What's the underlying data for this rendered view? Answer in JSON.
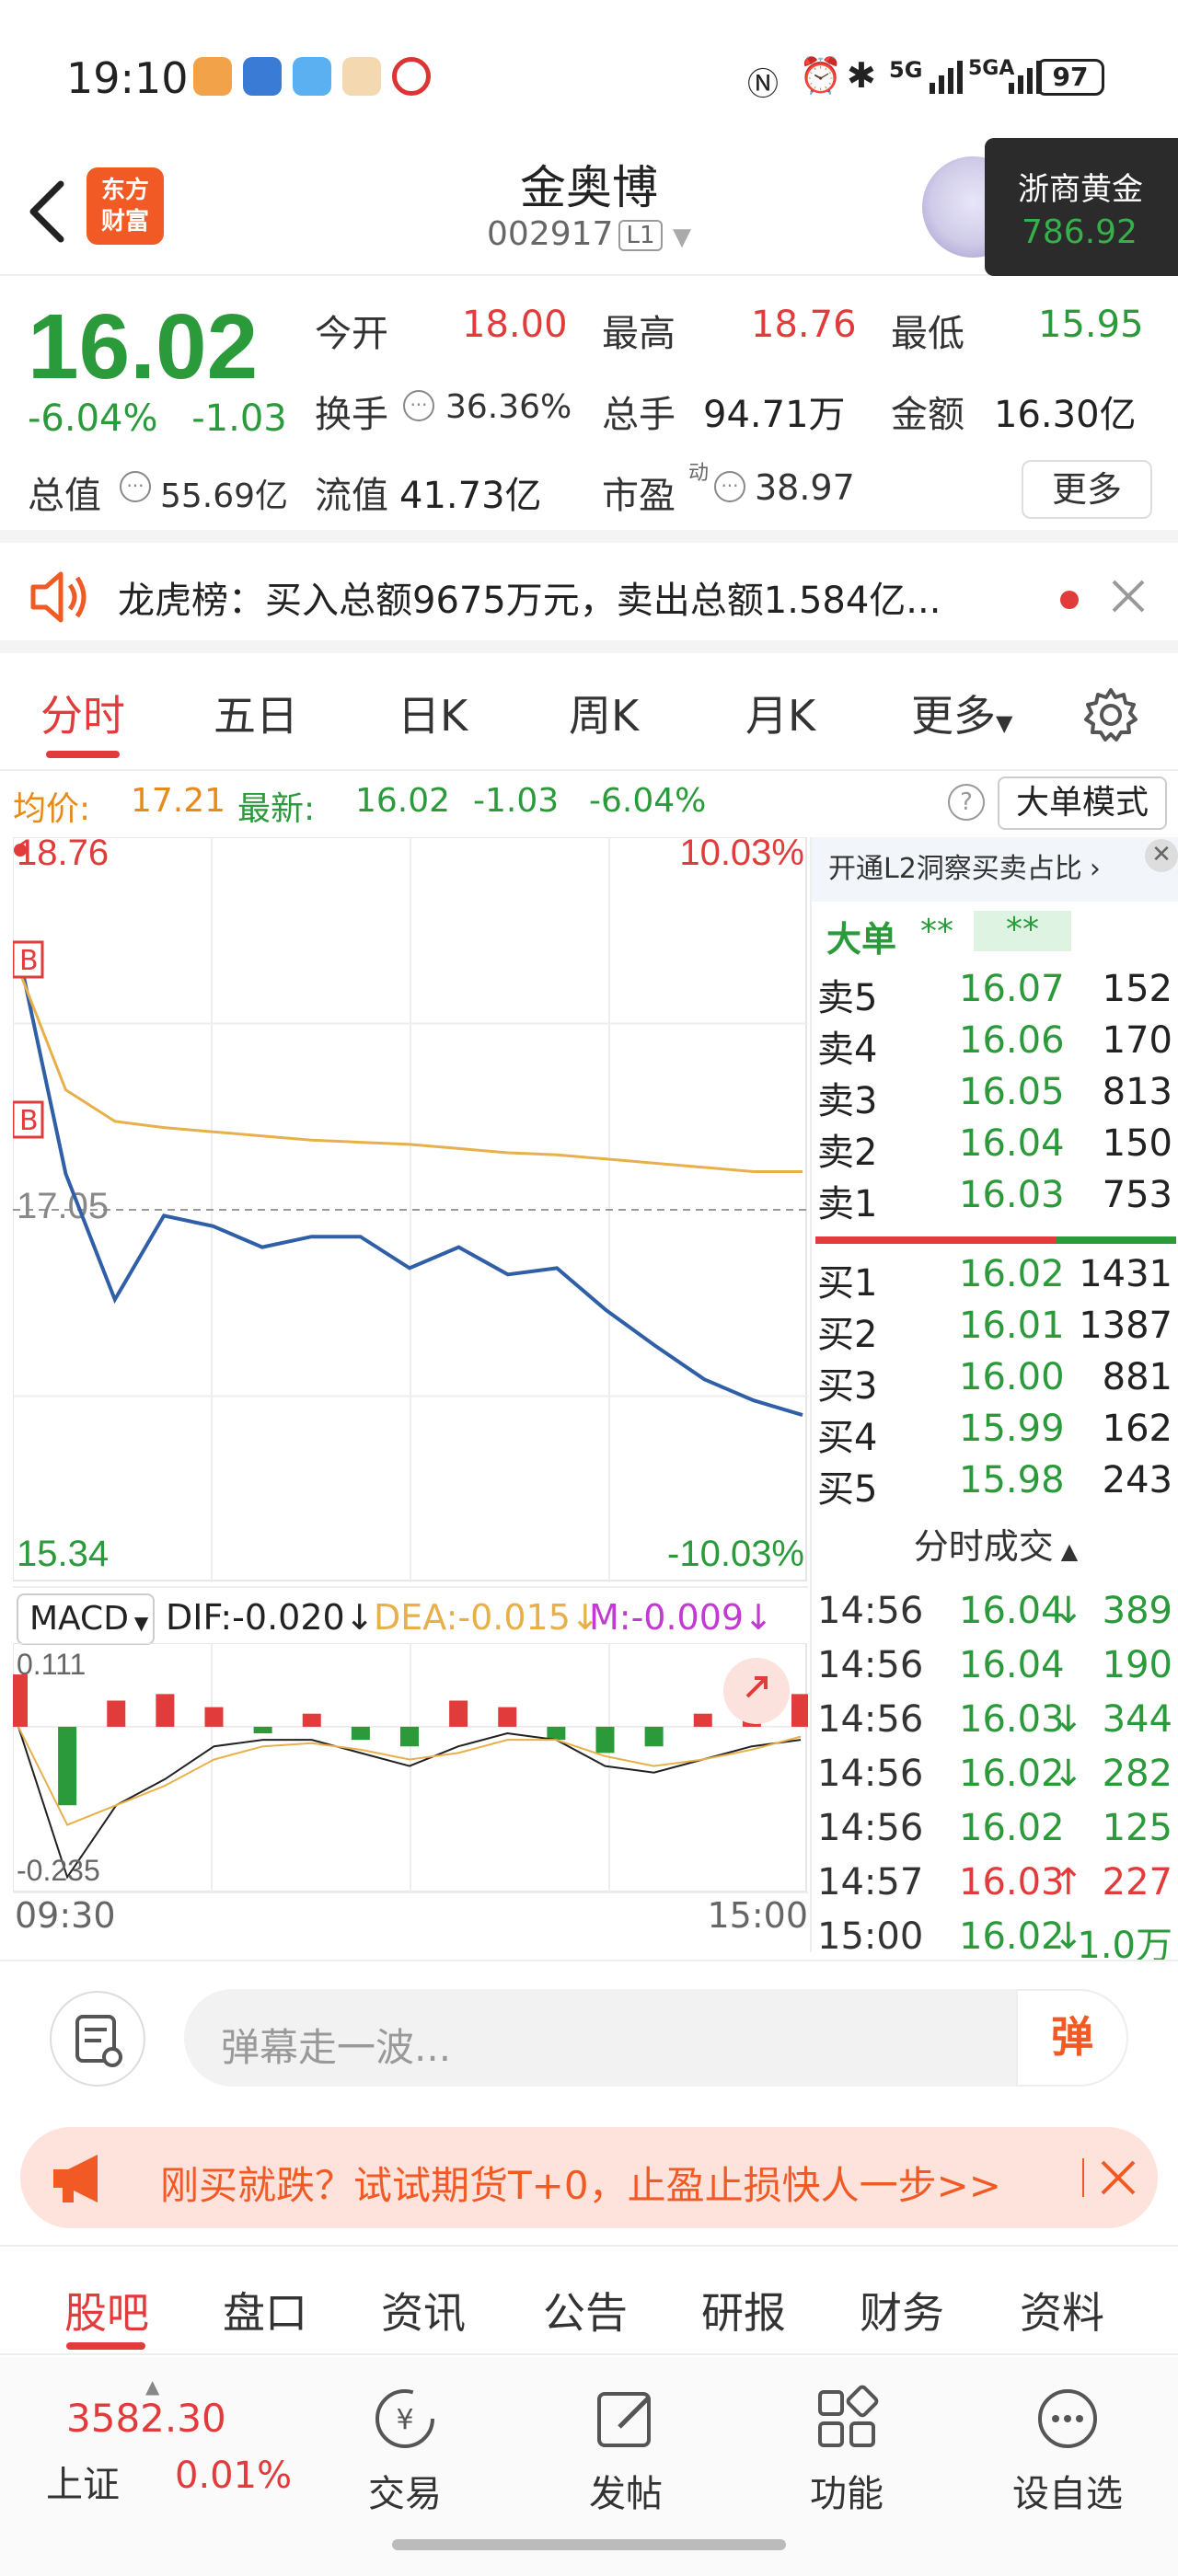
{
  "status_bar": {
    "time": "19:10",
    "network": "5G",
    "network2": "5GA",
    "battery": "97"
  },
  "header": {
    "stock_name": "金奥博",
    "stock_code": "002917",
    "level_badge": "L1",
    "logo_text_line1": "东方",
    "logo_text_line2": "财富",
    "gold_card": {
      "title": "浙商黄金",
      "value": "786.92"
    }
  },
  "quote": {
    "price": "16.02",
    "change_pct": "-6.04%",
    "change": "-1.03",
    "open_label": "今开",
    "open": "18.00",
    "high_label": "最高",
    "high": "18.76",
    "low_label": "最低",
    "low": "15.95",
    "turnover_label": "换手",
    "turnover": "36.36%",
    "volume_label": "总手",
    "volume": "94.71万",
    "amount_label": "金额",
    "amount": "16.30亿",
    "mktcap_label": "总值",
    "mktcap": "55.69亿",
    "float_label": "流值",
    "float": "41.73亿",
    "pe_label": "市盈",
    "pe_sup": "动",
    "pe": "38.97",
    "more_label": "更多"
  },
  "notice": {
    "text": "龙虎榜：买入总额9675万元，卖出总额1.584亿..."
  },
  "tabs": [
    "分时",
    "五日",
    "日K",
    "周K",
    "月K",
    "更多"
  ],
  "infoline": {
    "avg_label": "均价:",
    "avg": "17.21",
    "last_label": "最新:",
    "last": "16.02",
    "chg": "-1.03",
    "chg_pct": "-6.04%",
    "mode_label": "大单模式"
  },
  "chart_labels": {
    "top_price": "18.76",
    "top_pct": "10.03%",
    "mid_price": "17.05",
    "bottom_price": "15.34",
    "bottom_pct": "-10.03%",
    "macd_label": "MACD",
    "dif": "DIF:-0.020",
    "dea": "DEA:-0.015",
    "m": "M:-0.009",
    "macd_top": "0.111",
    "macd_bottom": "-0.235",
    "time_start": "09:30",
    "time_end": "15:00",
    "marker": "B"
  },
  "chart_data": {
    "type": "line",
    "title": "",
    "xlabel": "",
    "ylabel": "",
    "ylim": [
      15.34,
      18.76
    ],
    "x": [
      "09:30",
      "09:45",
      "10:00",
      "10:15",
      "10:30",
      "10:45",
      "11:00",
      "11:15",
      "11:30",
      "13:15",
      "13:30",
      "13:45",
      "14:00",
      "14:15",
      "14:30",
      "14:45",
      "15:00"
    ],
    "series": [
      {
        "values": [
          18.3,
          17.2,
          16.6,
          17.0,
          16.95,
          16.85,
          16.9,
          16.9,
          16.75,
          16.85,
          16.72,
          16.75,
          16.55,
          16.38,
          16.22,
          16.12,
          16.05
        ]
      },
      {
        "values": [
          18.2,
          17.6,
          17.45,
          17.42,
          17.4,
          17.38,
          17.36,
          17.35,
          17.34,
          17.32,
          17.3,
          17.29,
          17.27,
          17.25,
          17.23,
          17.21,
          17.21
        ]
      }
    ],
    "macd": {
      "ylim": [
        -0.235,
        0.111
      ],
      "dif": [
        0.0,
        -0.23,
        -0.12,
        -0.08,
        -0.03,
        -0.02,
        -0.02,
        -0.04,
        -0.06,
        -0.03,
        -0.01,
        -0.02,
        -0.06,
        -0.07,
        -0.05,
        -0.03,
        -0.02
      ],
      "dea": [
        0.0,
        -0.15,
        -0.12,
        -0.09,
        -0.05,
        -0.03,
        -0.025,
        -0.035,
        -0.05,
        -0.04,
        -0.02,
        -0.02,
        -0.045,
        -0.06,
        -0.05,
        -0.035,
        -0.015
      ],
      "hist": [
        0.08,
        -0.12,
        0.04,
        0.05,
        0.03,
        -0.01,
        0.02,
        -0.02,
        -0.03,
        0.04,
        0.03,
        -0.02,
        -0.04,
        -0.03,
        0.02,
        0.03,
        0.05
      ]
    }
  },
  "orderbook": {
    "banner": "开通L2洞察买卖占比",
    "big_label": "大单",
    "stars1": "**",
    "stars2": "**",
    "asks": [
      {
        "label": "卖5",
        "price": "16.07",
        "vol": "152"
      },
      {
        "label": "卖4",
        "price": "16.06",
        "vol": "170"
      },
      {
        "label": "卖3",
        "price": "16.05",
        "vol": "813"
      },
      {
        "label": "卖2",
        "price": "16.04",
        "vol": "150"
      },
      {
        "label": "卖1",
        "price": "16.03",
        "vol": "753"
      }
    ],
    "bids": [
      {
        "label": "买1",
        "price": "16.02",
        "vol": "1431"
      },
      {
        "label": "买2",
        "price": "16.01",
        "vol": "1387"
      },
      {
        "label": "买3",
        "price": "16.00",
        "vol": "881"
      },
      {
        "label": "买4",
        "price": "15.99",
        "vol": "162"
      },
      {
        "label": "买5",
        "price": "15.98",
        "vol": "243"
      }
    ],
    "ticks_title": "分时成交",
    "ticks": [
      {
        "time": "14:56",
        "price": "16.04",
        "dir": "down",
        "vol": "389"
      },
      {
        "time": "14:56",
        "price": "16.04",
        "dir": "",
        "vol": "190"
      },
      {
        "time": "14:56",
        "price": "16.03",
        "dir": "down",
        "vol": "344"
      },
      {
        "time": "14:56",
        "price": "16.02",
        "dir": "down",
        "vol": "282"
      },
      {
        "time": "14:56",
        "price": "16.02",
        "dir": "",
        "vol": "125"
      },
      {
        "time": "14:57",
        "price": "16.03",
        "dir": "up",
        "vol": "227"
      },
      {
        "time": "15:00",
        "price": "16.02",
        "dir": "down",
        "vol": "1.0万"
      }
    ]
  },
  "danmaku": {
    "placeholder": "弹幕走一波...",
    "button": "弹"
  },
  "promo": {
    "text": "刚买就跌？试试期货T+0，止盈止损快人一步>>"
  },
  "subtabs": [
    "股吧",
    "盘口",
    "资讯",
    "公告",
    "研报",
    "财务",
    "资料"
  ],
  "bottom_nav": {
    "index_value": "3582.30",
    "index_name": "上证",
    "index_pct": "0.01%",
    "items": [
      "交易",
      "发帖",
      "功能",
      "设自选"
    ]
  },
  "colors": {
    "up": "#e23b3b",
    "down": "#2a9a3a",
    "accent": "#f15a24",
    "avg_line": "#e8b04a",
    "price_line": "#2f5fa7"
  }
}
